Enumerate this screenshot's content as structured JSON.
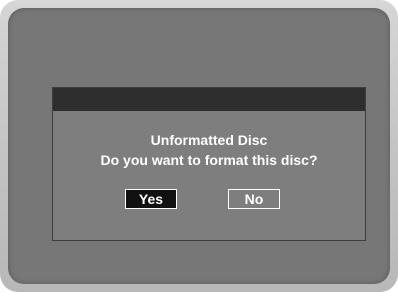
{
  "dialog": {
    "title": "Unformatted Disc",
    "question": "Do you want to format this disc?",
    "yes_label": "Yes",
    "no_label": "No",
    "selected_option": "Yes"
  },
  "colors": {
    "screen_background": "#777777",
    "dialog_background": "#7e7e7e",
    "dialog_titlebar": "#2e2e2e",
    "selected_button": "#111111",
    "text": "#ffffff"
  }
}
